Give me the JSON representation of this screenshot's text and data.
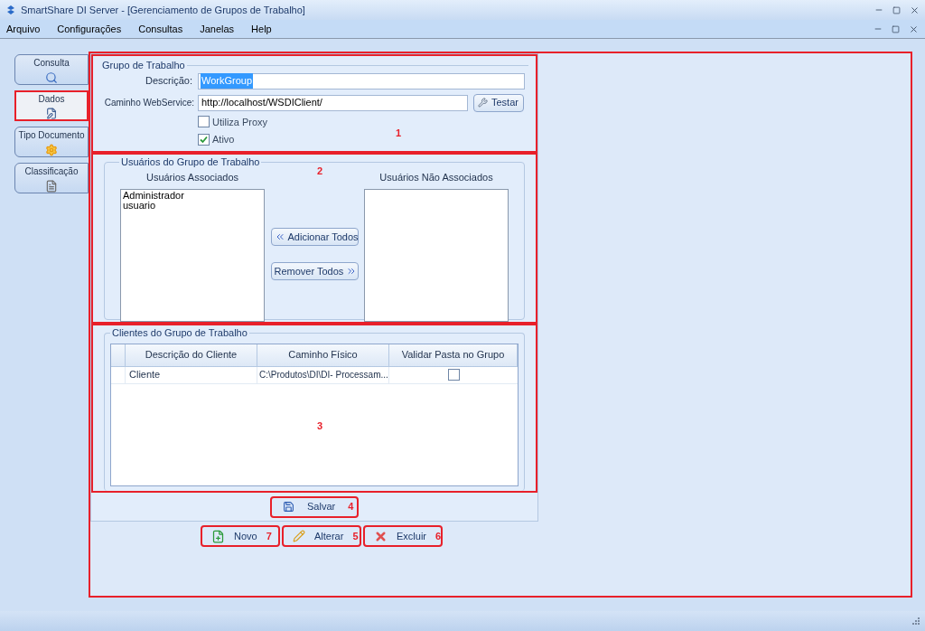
{
  "window": {
    "title": "SmartShare DI Server - [Gerenciamento de Grupos de Trabalho]"
  },
  "menu": [
    "Arquivo",
    "Configurações",
    "Consultas",
    "Janelas",
    "Help"
  ],
  "tabs": [
    {
      "label": "Consulta",
      "selected": false,
      "kind": "search",
      "annotated": false
    },
    {
      "label": "Dados",
      "selected": true,
      "kind": "edit",
      "annotated": true
    },
    {
      "label": "Tipo Documento",
      "selected": false,
      "kind": "gear",
      "annotated": false
    },
    {
      "label": "Classificação",
      "selected": false,
      "kind": "doc",
      "annotated": false
    }
  ],
  "grupo": {
    "legend": "Grupo de Trabalho",
    "annotation": "1",
    "descricao_label": "Descrição:",
    "descricao_value": "WorkGroup",
    "caminho_label": "Caminho WebService:",
    "caminho_value": "http://localhost/WSDIClient/",
    "test_button": "Testar",
    "checkboxes": [
      {
        "label": "Utiliza Proxy",
        "checked": false
      },
      {
        "label": "Ativo",
        "checked": true
      }
    ]
  },
  "usuarios": {
    "legend": "Usuários do Grupo de Trabalho",
    "annotation": "2",
    "associated_title": "Usuários Associados",
    "associated": [
      "Administrador",
      "usuario"
    ],
    "not_associated_title": "Usuários Não Associados",
    "add_all_button": "Adicionar Todos",
    "remove_all_button": "Remover Todos"
  },
  "clientes": {
    "legend": "Clientes do Grupo de Trabalho",
    "annotation": "3",
    "columns": [
      "Descrição do Cliente",
      "Caminho Físico",
      "Validar Pasta no Grupo"
    ],
    "rows": [
      {
        "descricao": "Cliente",
        "caminho": "C:\\Produtos\\DI\\DI- Processam...",
        "validar": false
      }
    ]
  },
  "save_button": {
    "label": "Salvar",
    "annotation": "4"
  },
  "actions": [
    {
      "label": "Novo",
      "annotation": "7",
      "kind": "new"
    },
    {
      "label": "Alterar",
      "annotation": "5",
      "kind": "edit"
    },
    {
      "label": "Excluir",
      "annotation": "6",
      "kind": "delete"
    }
  ]
}
